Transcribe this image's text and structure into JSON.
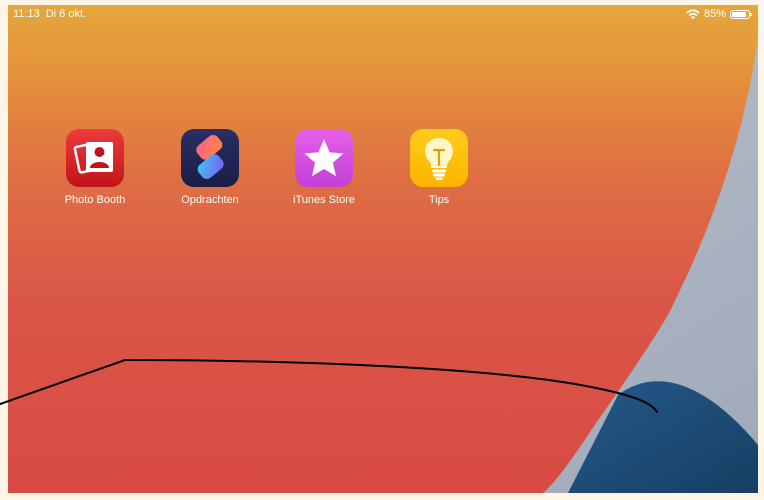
{
  "status_bar": {
    "time": "11:13",
    "date": "Di 6 okt.",
    "battery_percent_label": "85%",
    "battery_level": 0.85,
    "wifi_icon": "wifi-icon",
    "battery_icon": "battery-icon"
  },
  "apps": [
    {
      "label": "Photo Booth",
      "icon": "photo-booth-icon"
    },
    {
      "label": "Opdrachten",
      "icon": "shortcuts-icon"
    },
    {
      "label": "iTunes Store",
      "icon": "itunes-store-icon"
    },
    {
      "label": "Tips",
      "icon": "tips-icon"
    }
  ],
  "colors": {
    "wallpaper_top": "#e4a73d",
    "wallpaper_red": "#d9534a",
    "wallpaper_gray": "#b0b8c6",
    "wallpaper_blue": "#1f4f78",
    "annotation_stroke": "#000000"
  }
}
